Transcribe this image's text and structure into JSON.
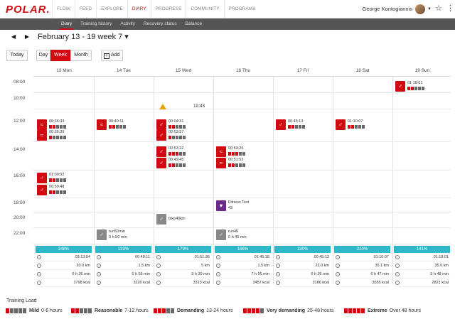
{
  "app": {
    "logo": "POLAR.",
    "user": "George Kontogiannis"
  },
  "nav": [
    "FLOW",
    "FEED",
    "EXPLORE",
    "DIARY",
    "PROGRESS",
    "COMMUNITY",
    "PROGRAMS"
  ],
  "subnav": [
    "Diary",
    "Training history",
    "Activity",
    "Recovery status",
    "Balance"
  ],
  "header": {
    "title": "February 13 - 19 week 7 ▾",
    "today": "Today",
    "day": "Day",
    "week": "Week",
    "month": "Month",
    "add": "Add"
  },
  "days": [
    "13 Mon",
    "14 Tue",
    "15 Wed",
    "16 Thu",
    "17 Fri",
    "18 Sat",
    "19 Sun"
  ],
  "hours": [
    "08:00",
    "10:00",
    "12:00",
    "14:00",
    "16:00",
    "18:00",
    "20:00",
    "22:00"
  ],
  "sessions": [
    {
      "time": "00:36:33"
    },
    {
      "time": "00:36:39"
    },
    {
      "time": "01:00:02"
    },
    {
      "time": "00:59:48"
    },
    {
      "time": "00:40:11"
    },
    {
      "time": "00:04:31"
    },
    {
      "time": "00:03:57"
    },
    {
      "time": "00:53:22"
    },
    {
      "time": "00:49:45"
    },
    {
      "time": "00:53:26"
    },
    {
      "time": "00:51:52"
    },
    {
      "time": "00:45:13"
    },
    {
      "time": "01:10:07"
    },
    {
      "time": "01:18:01"
    }
  ],
  "extras": {
    "wed_time": "10:43",
    "fitness_test": "Fitness Test",
    "fitness_value": "43",
    "bike": "bike40km",
    "run50": "run50min",
    "run50_dur": "0 h 50 min",
    "run45": "run45",
    "run45_dur": "0 h 45 min"
  },
  "summaries": [
    {
      "load": "248%",
      "time": "03:13:04",
      "dist": "30.0 km",
      "dur": "6 h 36 min",
      "kcal": "3798 kcal"
    },
    {
      "load": "133%",
      "time": "00:40:11",
      "dist": "1.5 km",
      "dur": "5 h 59 min",
      "kcal": "3220 kcal"
    },
    {
      "load": "179%",
      "time": "01:51:36",
      "dist": "5 km",
      "dur": "5 h 39 min",
      "kcal": "3313 kcal"
    },
    {
      "load": "166%",
      "time": "01:45:18",
      "dist": "1.5 km",
      "dur": "7 h 56 min",
      "kcal": "3457 kcal"
    },
    {
      "load": "130%",
      "time": "00:45:13",
      "dist": "22.0 km",
      "dur": "6 h 36 min",
      "kcal": "3186 kcal"
    },
    {
      "load": "220%",
      "time": "01:10:07",
      "dist": "35.1 km",
      "dur": "6 h 47 min",
      "kcal": "3555 kcal"
    },
    {
      "load": "141%",
      "time": "01:18:01",
      "dist": "35.0 km",
      "dur": "5 h 48 min",
      "kcal": "2821 kcal"
    }
  ],
  "training_load": {
    "title": "Training Load",
    "legend": [
      {
        "name": "Mild",
        "range": "0-6 hours"
      },
      {
        "name": "Reasonable",
        "range": "7-12 hours"
      },
      {
        "name": "Demanding",
        "range": "13-24 hours"
      },
      {
        "name": "Very demanding",
        "range": "25-48 hours"
      },
      {
        "name": "Extreme",
        "range": "Over 48 hours"
      }
    ]
  },
  "colors": {
    "brand": "#d10a11",
    "load_bar": "#2fb7c9",
    "fitness": "#6a2a8a"
  }
}
